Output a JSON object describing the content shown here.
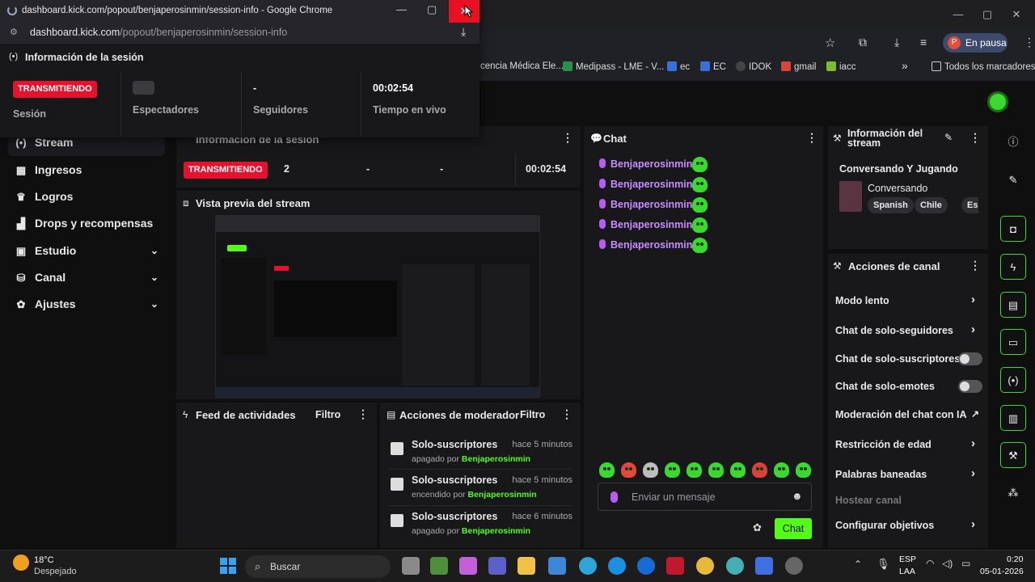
{
  "popup": {
    "title": "dashboard.kick.com/popout/benjaperosinmin/session-info - Google Chrome",
    "url_host": "dashboard.kick.com",
    "url_path": "/popout/benjaperosinmin/session-info",
    "header": "Información de la sesión",
    "status_badge": "TRANSMITIENDO",
    "session_label": "Sesión",
    "viewers_label": "Espectadores",
    "followers_value": "-",
    "followers_label": "Seguidores",
    "live_time_value": "00:02:54",
    "live_time_label": "Tiempo en vivo"
  },
  "browser": {
    "profile_initial": "P",
    "profile_status": "En pausa",
    "bookmarks": [
      "cencia Médica Ele...",
      "Medipass - LME - V...",
      "ec",
      "EC",
      "IDOK",
      "gmail",
      "iacc"
    ],
    "all_bookmarks": "Todos los marcadores",
    "more": "»"
  },
  "sidebar": {
    "items": [
      {
        "label": "Stream",
        "icon": "broadcast-icon"
      },
      {
        "label": "Ingresos",
        "icon": "chart-icon"
      },
      {
        "label": "Logros",
        "icon": "trophy-icon"
      },
      {
        "label": "Drops y recompensas",
        "icon": "drops-icon"
      },
      {
        "label": "Estudio",
        "icon": "studio-icon"
      },
      {
        "label": "Canal",
        "icon": "channel-icon"
      },
      {
        "label": "Ajustes",
        "icon": "gear-icon"
      }
    ]
  },
  "session_panel": {
    "title": "Información de la sesión",
    "badge": "TRANSMITIENDO",
    "viewers": "2",
    "followers": "-",
    "subs": "-",
    "time": "00:02:54"
  },
  "preview": {
    "title": "Vista previa del stream"
  },
  "activity": {
    "title": "Feed de actividades",
    "filter": "Filtro"
  },
  "mod_actions": {
    "title": "Acciones de moderador",
    "filter": "Filtro",
    "items": [
      {
        "title": "Solo-suscriptores",
        "when": "hace 5 minutos",
        "action": "apagado por",
        "user": "Benjaperosinmin"
      },
      {
        "title": "Solo-suscriptores",
        "when": "hace 5 minutos",
        "action": "encendido por",
        "user": "Benjaperosinmin"
      },
      {
        "title": "Solo-suscriptores",
        "when": "hace 6 minutos",
        "action": "apagado por",
        "user": "Benjaperosinmin"
      }
    ]
  },
  "chat": {
    "title": "Chat",
    "messages": [
      {
        "user": "Benjaperosinmin:"
      },
      {
        "user": "Benjaperosinmin:"
      },
      {
        "user": "Benjaperosinmin:"
      },
      {
        "user": "Benjaperosinmin:"
      },
      {
        "user": "Benjaperosinmin:"
      }
    ],
    "input_placeholder": "Enviar un mensaje",
    "send_label": "Chat"
  },
  "stream_info": {
    "title": "Información del stream",
    "stream_title": "Conversando Y Jugando",
    "category": "Conversando",
    "tags": [
      "Spanish",
      "Chile",
      "Espar"
    ]
  },
  "channel_actions": {
    "title": "Acciones de canal",
    "items": [
      {
        "label": "Modo lento",
        "control": "arrow"
      },
      {
        "label": "Chat de solo-seguidores",
        "control": "arrow"
      },
      {
        "label": "Chat de solo-suscriptores",
        "control": "toggle"
      },
      {
        "label": "Chat de solo-emotes",
        "control": "toggle"
      },
      {
        "label": "Moderación del chat con IA",
        "control": "external"
      },
      {
        "label": "Restricción de edad",
        "control": "arrow"
      },
      {
        "label": "Palabras baneadas",
        "control": "arrow"
      },
      {
        "label": "Hostear canal",
        "control": "none"
      },
      {
        "label": "Configurar objetivos",
        "control": "arrow"
      }
    ]
  },
  "taskbar": {
    "temp": "18°C",
    "weather": "Despejado",
    "search": "Buscar",
    "lang": "ESP",
    "lang2": "LAA",
    "time": "0:20",
    "date": "05-01-2026"
  },
  "colors": {
    "accent": "#53fc18",
    "live": "#e8112d",
    "chat_user": "#c98cff"
  }
}
